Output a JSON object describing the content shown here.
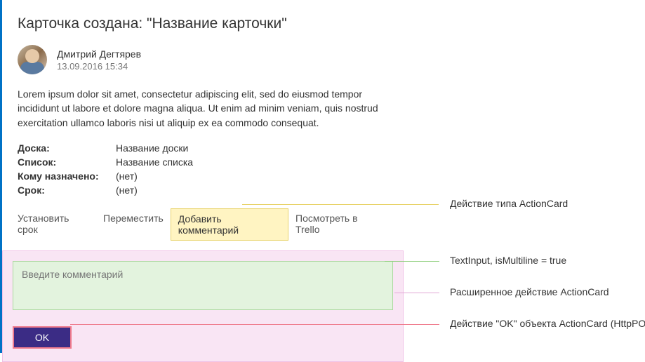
{
  "card": {
    "title": "Карточка создана: \"Название карточки\"",
    "author": {
      "name": "Дмитрий Дегтярев",
      "date": "13.09.2016 15:34"
    },
    "body": "Lorem ipsum dolor sit amet, consectetur adipiscing elit, sed do eiusmod tempor incididunt ut labore et dolore magna aliqua. Ut enim ad minim veniam, quis nostrud exercitation ullamco laboris nisi ut aliquip ex ea commodo consequat.",
    "facts": [
      {
        "label": "Доска:",
        "value": "Название доски"
      },
      {
        "label": "Список:",
        "value": "Название списка"
      },
      {
        "label": "Кому назначено:",
        "value": "(нет)"
      },
      {
        "label": "Срок:",
        "value": "(нет)"
      }
    ],
    "actions": [
      {
        "label": "Установить срок",
        "active": false
      },
      {
        "label": "Переместить",
        "active": false
      },
      {
        "label": "Добавить комментарий",
        "active": true
      },
      {
        "label": "Посмотреть в Trello",
        "active": false
      }
    ],
    "input_placeholder": "Введите комментарий",
    "ok_label": "OK"
  },
  "annotations": {
    "action_card": "Действие типа ActionCard",
    "text_input": "TextInput, isMultiline = true",
    "expanded": "Расширенное действие ActionCard",
    "ok": "Действие \"OK\" объекта ActionCard (HttpPOST)"
  }
}
